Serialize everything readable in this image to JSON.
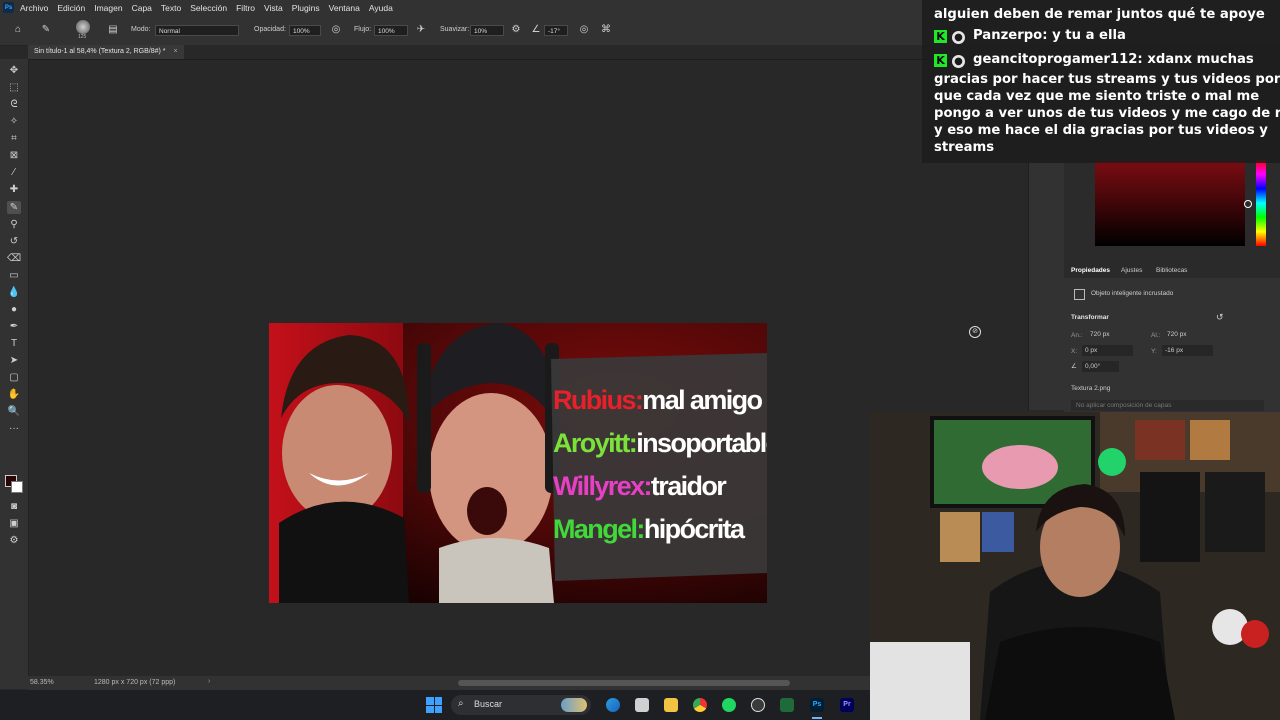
{
  "menubar": {
    "app_logo": "Ps",
    "items": [
      "Archivo",
      "Edición",
      "Imagen",
      "Capa",
      "Texto",
      "Selección",
      "Filtro",
      "Vista",
      "Plugins",
      "Ventana",
      "Ayuda"
    ]
  },
  "options": {
    "brush_size": "125",
    "mode_label": "Modo:",
    "mode_value": "Normal",
    "opacity_label": "Opacidad:",
    "opacity_value": "100%",
    "flow_label": "Flujo:",
    "flow_value": "100%",
    "smoothing_label": "Suavizar:",
    "smoothing_value": "10%",
    "angle_value": "-17°"
  },
  "document": {
    "tab_title": "Sin título-1 al 58,4% (Textura 2, RGB/8#) *",
    "tab_close": "×"
  },
  "thumbnail": {
    "lines": [
      {
        "name": "Rubius:",
        "text": "mal amigo",
        "color": "#e8202a"
      },
      {
        "name": "Aroyitt:",
        "text": "insoportable!",
        "color": "#7be23a"
      },
      {
        "name": "Willyrex:",
        "text": "traidor",
        "color": "#e83fc4"
      },
      {
        "name": "Mangel:",
        "text": "hipócrita",
        "color": "#41d93a"
      }
    ]
  },
  "properties": {
    "tabs": [
      "Propiedades",
      "Ajustes",
      "Bibliotecas"
    ],
    "layer_type": "Objeto inteligente incrustado",
    "section": "Transformar",
    "w_label": "An.:",
    "w_value": "720 px",
    "h_label": "Al.:",
    "h_value": "720 px",
    "x_label": "X:",
    "x_value": "0 px",
    "y_label": "Y:",
    "y_value": "-16 px",
    "angle_value": "0,00°",
    "file_name": "Textura 2.png",
    "comp_placeholder": "No aplicar composición de capas"
  },
  "status": {
    "zoom": "58.35%",
    "doc_info": "1280 px x 720 px (72 ppp)"
  },
  "taskbar": {
    "search_placeholder": "Buscar"
  },
  "chat": {
    "line0": "alguien deben de remar juntos qué te apoye",
    "msg1_user": "Panzerpo:",
    "msg1_text": "y tu a ella",
    "msg2_user": "geancitoprogamer112:",
    "msg2_text_first": "xdanx muchas",
    "msg2_lines": [
      "gracias por hacer tus streams y tus videos por",
      "que cada vez que me siento triste o mal me",
      "pongo a ver unos de tus videos y me cago de risa",
      "y eso me hace el dia gracias por tus videos y",
      "streams"
    ]
  },
  "colors": {
    "accent": "#31a8ff",
    "kick_green": "#1ee828",
    "canvas_bg": "#282828"
  }
}
